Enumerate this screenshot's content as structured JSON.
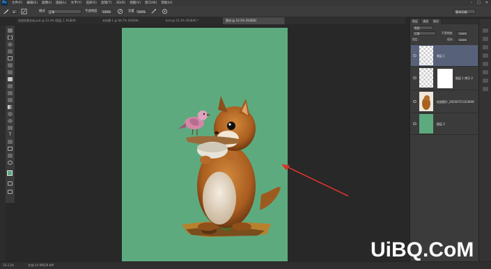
{
  "app": {
    "logo": "Ps"
  },
  "menubar": {
    "items": [
      "文件(F)",
      "编辑(E)",
      "图像(I)",
      "图层(L)",
      "文字(Y)",
      "选择(S)",
      "滤镜(T)",
      "3D(D)",
      "视图(V)",
      "窗口(W)",
      "帮助(H)"
    ],
    "window_controls": [
      "–",
      "□",
      "✕"
    ]
  },
  "options_bar": {
    "mode_label": "模式",
    "mode_value": "正常",
    "opacity_label": "不透明度",
    "opacity_value": "100%",
    "flow_label": "流量",
    "flow_value": "100%",
    "workspace_value": "基本功能"
  },
  "tabs": [
    {
      "label": "松鼠创意合成.psd @ 33.3% (图层 1, RGB/8)",
      "active": false
    },
    {
      "label": "未标题-1 @ 66.7% (RGB/8)",
      "active": false
    },
    {
      "label": "bird @ 25.3% (RGB/8) *",
      "active": false
    },
    {
      "label": "素材 @ 33.3% (RGB/8)",
      "active": true
    }
  ],
  "layers_panel": {
    "tabs": [
      "图层",
      "通道",
      "路径"
    ],
    "filter_value": "类型",
    "blend_mode": "正常",
    "opacity_label": "不透明度:",
    "opacity_value": "100%",
    "lock_label": "锁定:",
    "fill_label": "填充:",
    "fill_value": "100%",
    "layers": [
      {
        "name": "图层 1",
        "selected": true
      },
      {
        "name": "图层 1 拷贝 2",
        "selected": false
      },
      {
        "name": "松鼠图片_20230721103946",
        "selected": false
      },
      {
        "name": "图层 2",
        "selected": false
      }
    ]
  },
  "statusbar": {
    "zoom": "33.12%",
    "doc_info": "文档:24.9M/26.8M"
  },
  "watermark": {
    "text": "UiBQ.CoM"
  },
  "colors": {
    "canvas_bg": "#5eaa7f",
    "arrow": "#d9342b",
    "selected_layer": "#57627a"
  }
}
